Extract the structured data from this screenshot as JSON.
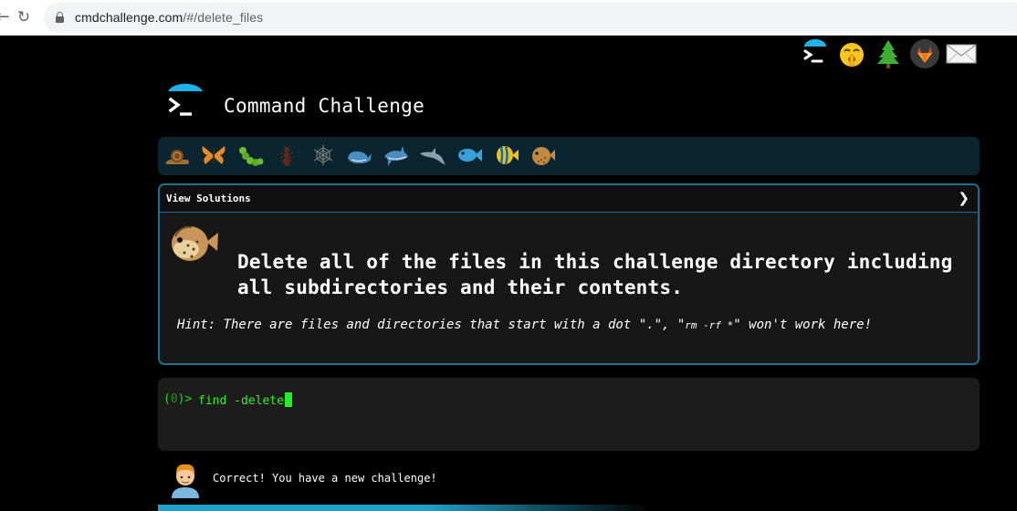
{
  "browser": {
    "url_domain": "cmdchallenge.com",
    "url_path": "/#/delete_files",
    "back_icon": "back-arrow-icon",
    "reload_icon": "reload-icon"
  },
  "top_links": [
    "cmdchallenge-icon",
    "shush-face-icon",
    "tree-icon",
    "gitlab-icon",
    "mail-icon"
  ],
  "site": {
    "title": "Command Challenge"
  },
  "levels": [
    "snail-icon",
    "butterfly-icon",
    "caterpillar-icon",
    "ant-icon",
    "spiderweb-icon",
    "whale-icon",
    "shark-icon",
    "dolphin-icon",
    "fish-icon",
    "tropical-fish-icon",
    "blowfish-icon"
  ],
  "panel": {
    "header": "View Solutions",
    "chevron": "❯",
    "challenge": "Delete all of the files in this challenge directory including all subdirectories and their contents.",
    "hint_prefix": "Hint: There are files and directories that start with a dot \".\", \"",
    "hint_cmd": "rm -rf *",
    "hint_suffix": "\" won't work here!"
  },
  "terminal": {
    "prompt_open": "(",
    "prompt_count": "0",
    "prompt_close": ")>",
    "input": "find -delete"
  },
  "result": {
    "message": "Correct! You have a new challenge!"
  },
  "colors": {
    "accent": "#1e6f8f",
    "prompt_green": "#2ecc2e",
    "level_bar": "#0a2430"
  }
}
